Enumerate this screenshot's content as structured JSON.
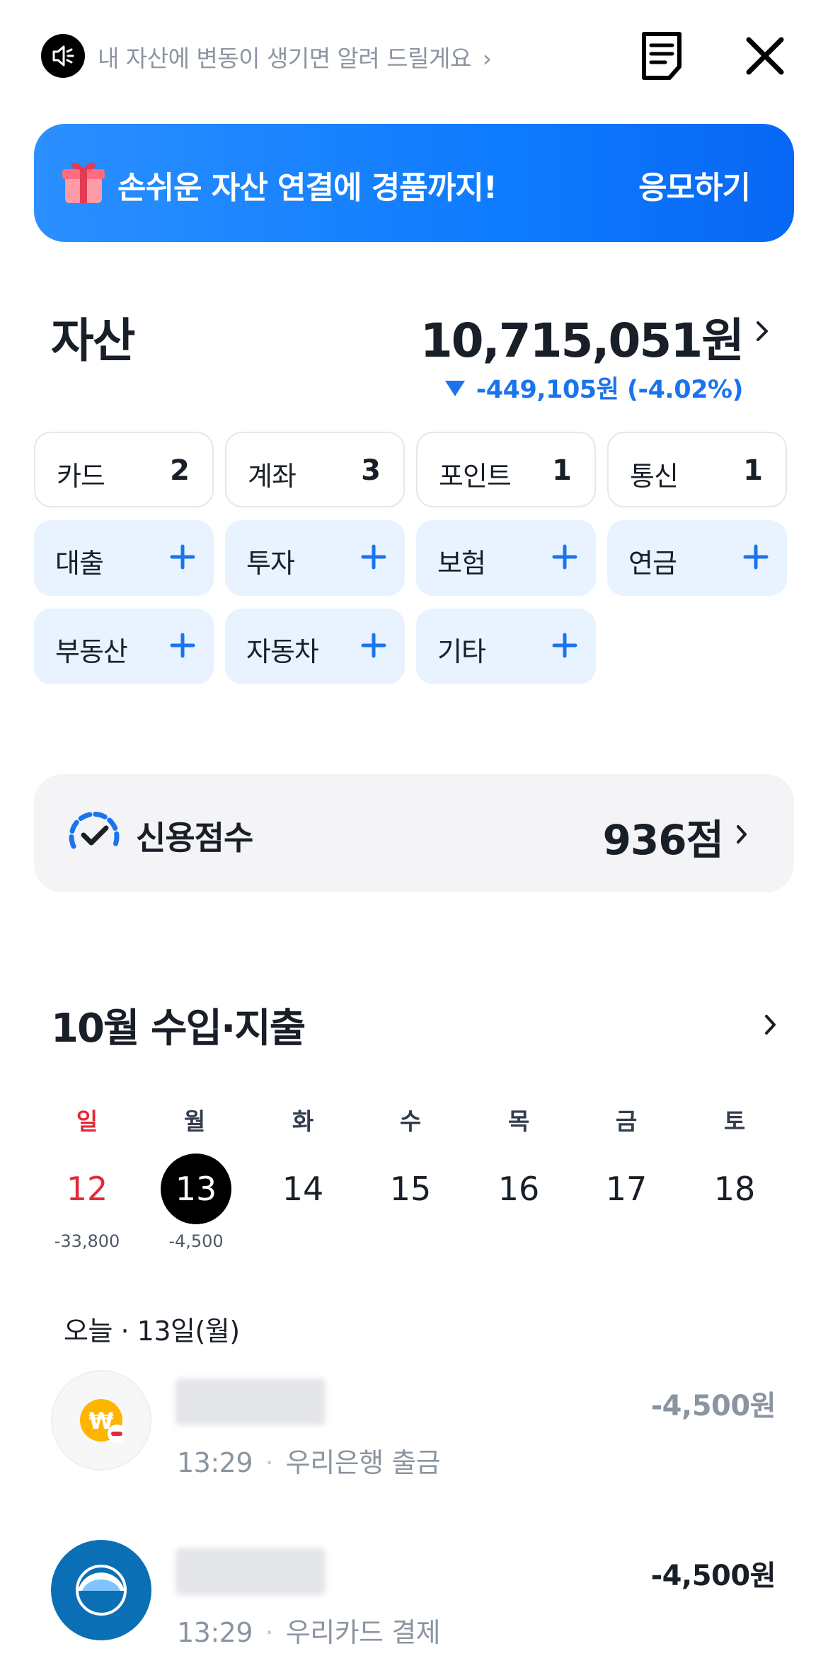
{
  "topbar": {
    "notice": "내 자산에 변동이 생기면 알려 드릴게요",
    "icons": [
      "speaker-icon",
      "document-icon",
      "close-icon"
    ]
  },
  "banner": {
    "text": "손쉬운 자산 연결에 경품까지!",
    "cta": "응모하기"
  },
  "assets": {
    "title": "자산",
    "total": "10,715,051원",
    "change": "-449,105원 (-4.02%)",
    "linked": [
      {
        "label": "카드",
        "count": "2"
      },
      {
        "label": "계좌",
        "count": "3"
      },
      {
        "label": "포인트",
        "count": "1"
      },
      {
        "label": "통신",
        "count": "1"
      }
    ],
    "unlinked": [
      {
        "label": "대출"
      },
      {
        "label": "투자"
      },
      {
        "label": "보험"
      },
      {
        "label": "연금"
      },
      {
        "label": "부동산"
      },
      {
        "label": "자동차"
      },
      {
        "label": "기타"
      }
    ]
  },
  "credit": {
    "label": "신용점수",
    "score": "936점"
  },
  "calendar": {
    "title": "10월 수입·지출",
    "weekdays": [
      "일",
      "월",
      "화",
      "수",
      "목",
      "금",
      "토"
    ],
    "days": [
      "12",
      "13",
      "14",
      "15",
      "16",
      "17",
      "18"
    ],
    "amounts": [
      "-33,800",
      "-4,500"
    ],
    "today_label": "오늘 · 13일(월)"
  },
  "transactions": [
    {
      "time": "13:29",
      "desc": "우리은행 출금",
      "amount": "-4,500원"
    },
    {
      "time": "13:29",
      "desc": "우리카드 결제",
      "amount": "-4,500원"
    }
  ],
  "colors": {
    "accent": "#1b74ee",
    "sunday": "#e42939",
    "chip_bg": "#e8f3ff"
  }
}
